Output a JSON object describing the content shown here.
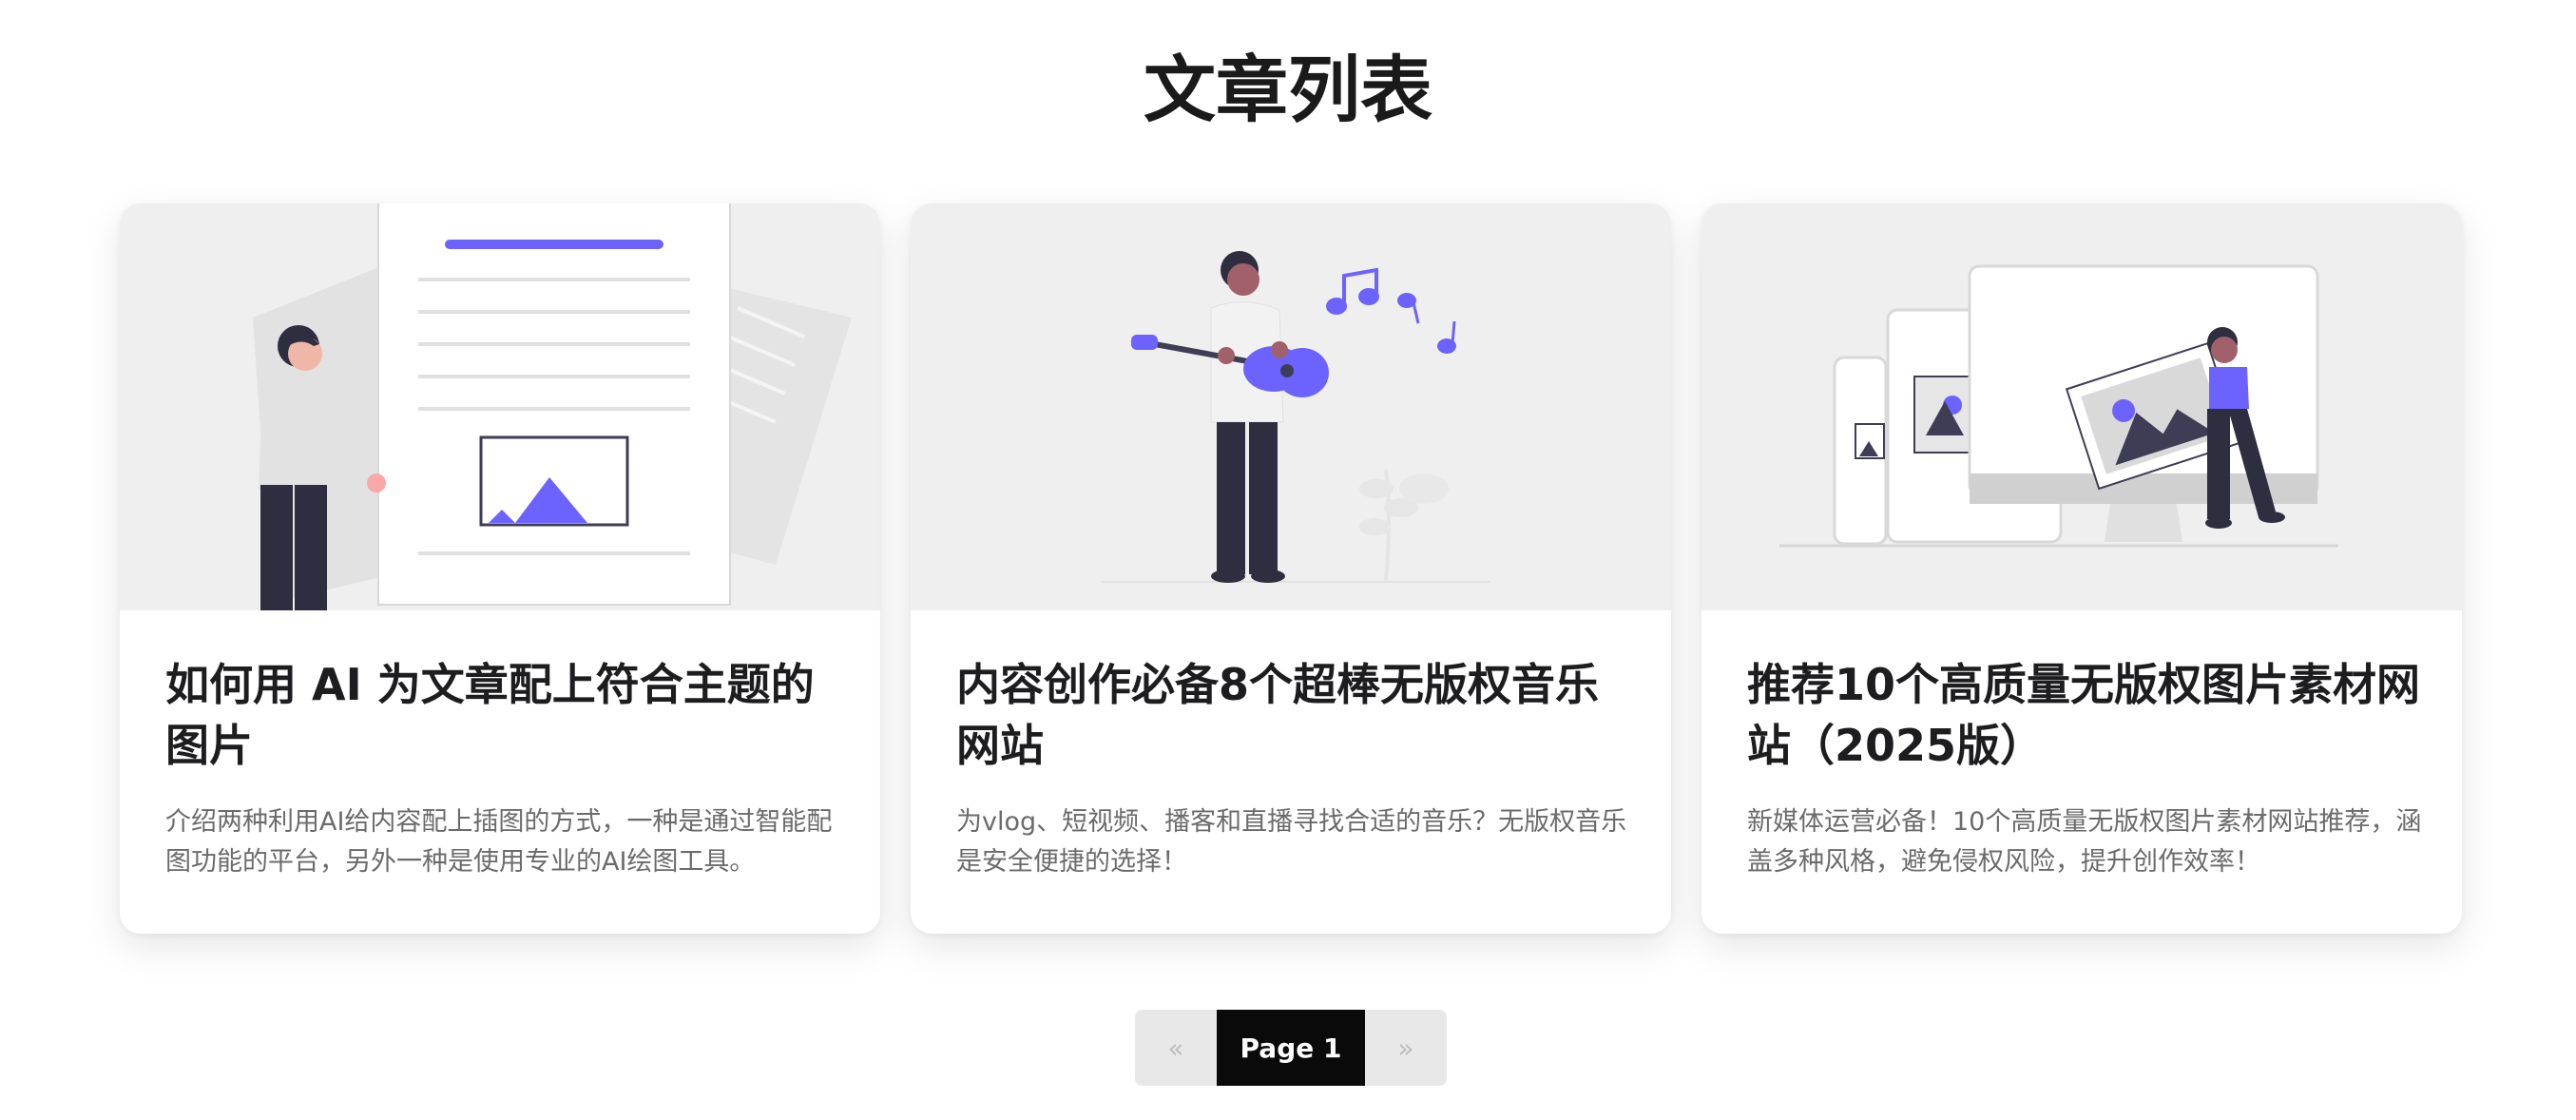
{
  "page": {
    "title": "文章列表"
  },
  "articles": [
    {
      "title": "如何用 AI 为文章配上符合主题的图片",
      "description": "介绍两种利用AI给内容配上插图的方式，一种是通过智能配图功能的平台，另外一种是使用专业的AI绘图工具。",
      "illustration": "person-presenting-document-icon"
    },
    {
      "title": "内容创作必备8个超棒无版权音乐网站",
      "description": "为vlog、短视频、播客和直播寻找合适的音乐？无版权音乐是安全便捷的选择！",
      "illustration": "person-playing-guitar-icon"
    },
    {
      "title": "推荐10个高质量无版权图片素材网站（2025版）",
      "description": "新媒体运营必备！10个高质量无版权图片素材网站推荐，涵盖多种风格，避免侵权风险，提升创作效率！",
      "illustration": "person-carrying-picture-devices-icon"
    }
  ],
  "pagination": {
    "prev": "«",
    "current": "Page 1",
    "next": "»"
  },
  "colors": {
    "accent": "#6c63ff",
    "dark": "#2f2e41",
    "card_image_bg": "#efefef"
  }
}
